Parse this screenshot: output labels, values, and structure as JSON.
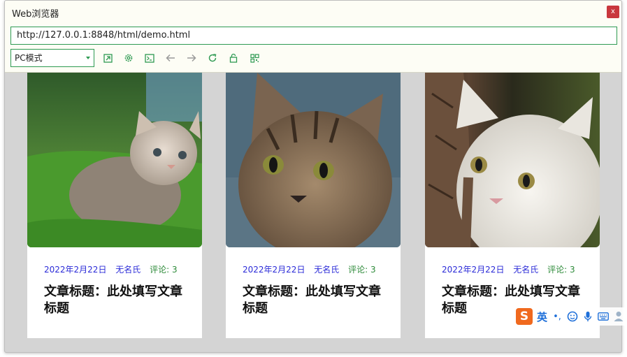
{
  "window": {
    "title": "Web浏览器",
    "close_label": "x"
  },
  "address": {
    "url": "http://127.0.0.1:8848/html/demo.html"
  },
  "toolbar": {
    "mode": "PC模式",
    "icons": [
      "open-external-icon",
      "settings-icon",
      "console-icon",
      "back-icon",
      "forward-icon",
      "reload-icon",
      "lock-icon",
      "qr-code-icon"
    ]
  },
  "cards": [
    {
      "photo": "kitten-on-grass",
      "date": "2022年2月22日",
      "author": "无名氏",
      "comments": "评论: 3",
      "title": "文章标题：此处填写文章标题"
    },
    {
      "photo": "tabby-cat-closeup",
      "date": "2022年2月22日",
      "author": "无名氏",
      "comments": "评论: 3",
      "title": "文章标题：此处填写文章标题"
    },
    {
      "photo": "white-cat-behind-tree",
      "date": "2022年2月22日",
      "author": "无名氏",
      "comments": "评论: 3",
      "title": "文章标题：此处填写文章标题"
    }
  ],
  "ime": {
    "logo": "S",
    "lang": "英",
    "punct": "•,",
    "icons": [
      "emoji-icon",
      "microphone-icon",
      "keyboard-icon",
      "user-icon"
    ]
  },
  "colors": {
    "accent": "#2e9a52",
    "meta_blue": "#2b2bd8",
    "meta_green": "#2e8b3a",
    "close_red": "#c9373d"
  }
}
